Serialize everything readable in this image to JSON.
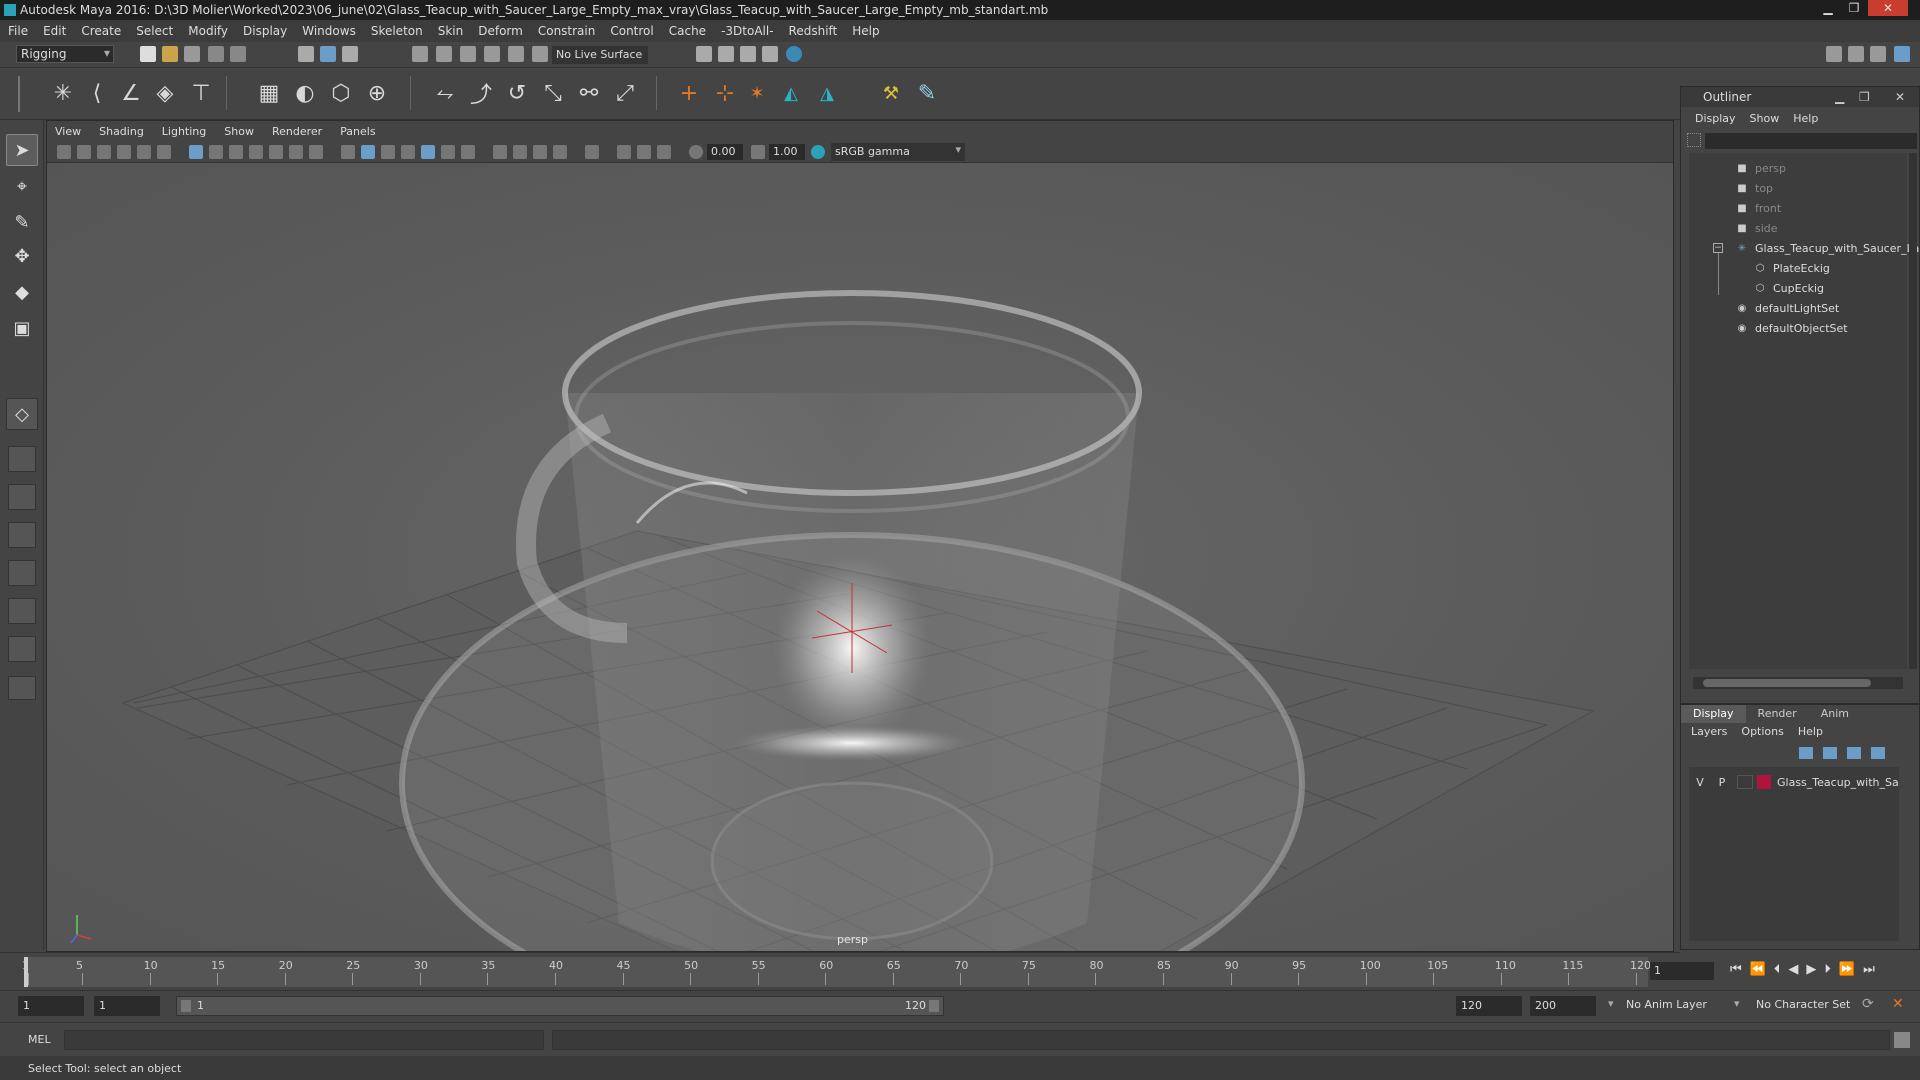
{
  "window": {
    "title": "Autodesk Maya 2016: D:\\3D Molier\\Worked\\2023\\06_june\\02\\Glass_Teacup_with_Saucer_Large_Empty_max_vray\\Glass_Teacup_with_Saucer_Large_Empty_mb_standart.mb"
  },
  "menubar": [
    "File",
    "Edit",
    "Create",
    "Select",
    "Modify",
    "Display",
    "Windows",
    "Skeleton",
    "Skin",
    "Deform",
    "Constrain",
    "Control",
    "Cache",
    "-3DtoAll-",
    "Redshift",
    "Help"
  ],
  "statusline": {
    "mode": "Rigging",
    "live_surface": "No Live Surface"
  },
  "viewport": {
    "menus": [
      "View",
      "Shading",
      "Lighting",
      "Show",
      "Renderer",
      "Panels"
    ],
    "field1": "0.00",
    "field2": "1.00",
    "color_space": "sRGB gamma",
    "camera_label": "persp"
  },
  "outliner": {
    "title": "Outliner",
    "menus": [
      "Display",
      "Show",
      "Help"
    ],
    "items": [
      {
        "label": "persp",
        "icon": "camera-icon",
        "dim": true
      },
      {
        "label": "top",
        "icon": "camera-icon",
        "dim": true
      },
      {
        "label": "front",
        "icon": "camera-icon",
        "dim": true
      },
      {
        "label": "side",
        "icon": "camera-icon",
        "dim": true
      },
      {
        "label": "Glass_Teacup_with_Saucer_Lar",
        "icon": "joint-icon",
        "dim": false
      },
      {
        "label": "PlateEckig",
        "icon": "mesh-icon",
        "dim": false
      },
      {
        "label": "CupEckig",
        "icon": "mesh-icon",
        "dim": false
      },
      {
        "label": "defaultLightSet",
        "icon": "set-icon",
        "dim": false
      },
      {
        "label": "defaultObjectSet",
        "icon": "set-icon",
        "dim": false
      }
    ]
  },
  "layers": {
    "tabs": [
      "Display",
      "Render",
      "Anim"
    ],
    "menus": [
      "Layers",
      "Options",
      "Help"
    ],
    "row": {
      "v": "V",
      "p": "P",
      "name": "Glass_Teacup_with_Sa",
      "color": "#b0143c"
    }
  },
  "timeline": {
    "ticks": [
      "1",
      "5",
      "10",
      "15",
      "20",
      "25",
      "30",
      "35",
      "40",
      "45",
      "50",
      "55",
      "60",
      "65",
      "70",
      "75",
      "80",
      "85",
      "90",
      "95",
      "100",
      "105",
      "110",
      "115",
      "120"
    ],
    "current_frame": "1"
  },
  "range": {
    "start": "1",
    "start2": "1",
    "slider_start": "1",
    "slider_end": "120",
    "end": "120",
    "end2": "200",
    "anim_layer": "No Anim Layer",
    "char_set": "No Character Set"
  },
  "cmdline": {
    "label": "MEL"
  },
  "helpline": {
    "text": "Select Tool: select an object"
  },
  "colors": {
    "accent": "#2aa3b8",
    "layer_color": "#b0143c"
  }
}
